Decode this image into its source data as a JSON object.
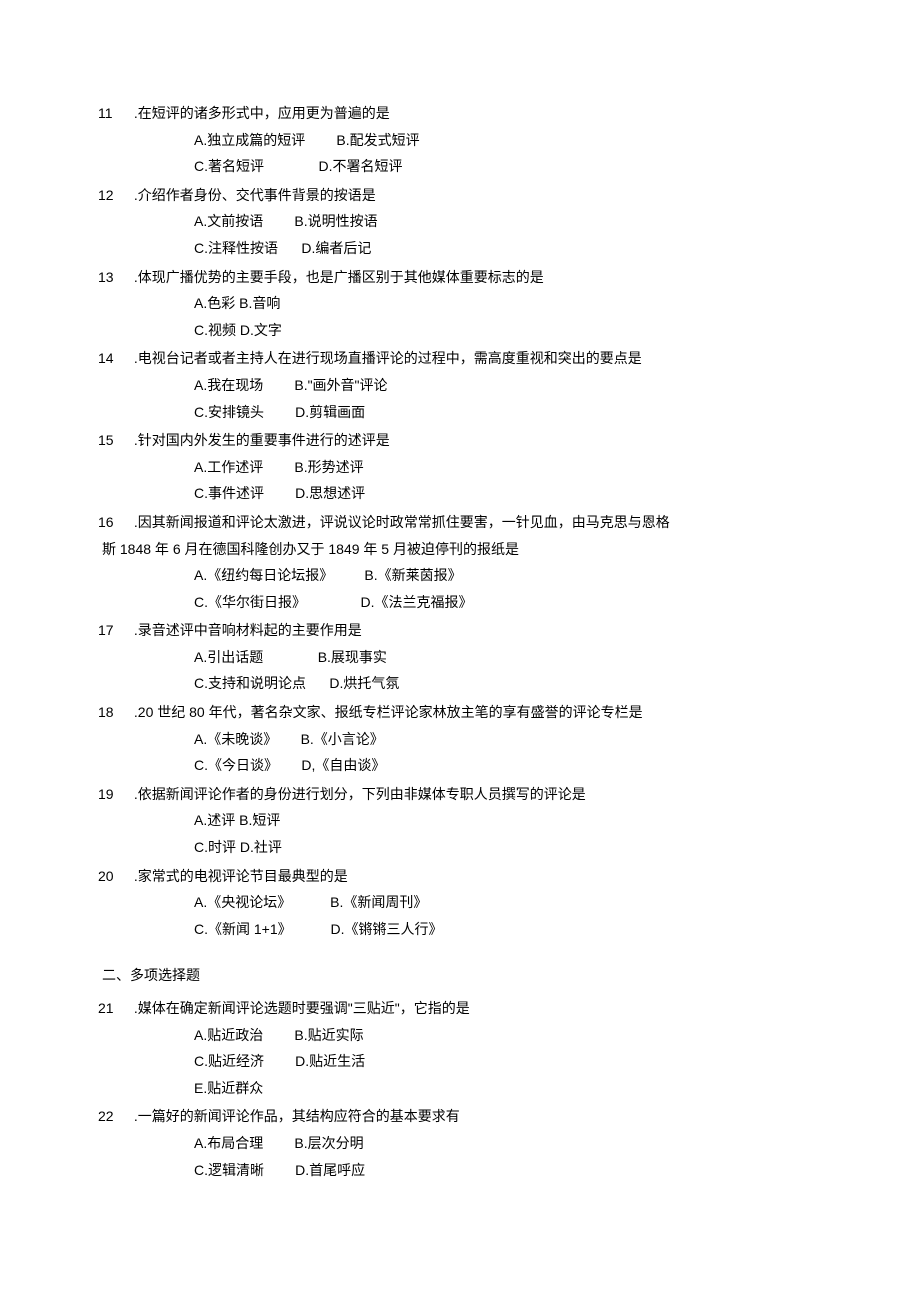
{
  "q11": {
    "num": "11",
    "stem": " .在短评的诸多形式中，应用更为普遍的是",
    "row1a": "A.独立成篇的短评",
    "row1b": "B.配发式短评",
    "row2a": "C.著名短评",
    "row2b": "D.不署名短评"
  },
  "q12": {
    "num": "12",
    "stem": " .介绍作者身份、交代事件背景的按语是",
    "row1a": "A.文前按语",
    "row1b": "B.说明性按语",
    "row2a": "C.注释性按语",
    "row2b": "D.编者后记"
  },
  "q13": {
    "num": "13",
    "stem": " .体现广播优势的主要手段，也是广播区别于其他媒体重要标志的是",
    "row1": "A.色彩 B.音响",
    "row2": "C.视频 D.文字"
  },
  "q14": {
    "num": "14",
    "stem": " .电视台记者或者主持人在进行现场直播评论的过程中，需高度重视和突出的要点是",
    "row1a": "A.我在现场",
    "row1b": "B.\"画外音\"评论",
    "row2a": "C.安排镜头",
    "row2b": "D.剪辑画面"
  },
  "q15": {
    "num": "15",
    "stem": " .针对国内外发生的重要事件进行的述评是",
    "row1a": "A.工作述评",
    "row1b": "B.形势述评",
    "row2a": "C.事件述评",
    "row2b": "D.思想述评"
  },
  "q16": {
    "num": "16",
    "stem": " .因其新闻报道和评论太激进，评说议论时政常常抓住要害，一针见血，由马克思与恩格",
    "stem2": "斯 1848 年 6 月在德国科隆创办又于 1849 年 5 月被迫停刊的报纸是",
    "row1a": "A.《纽约每日论坛报》",
    "row1b": "B.《新莱茵报》",
    "row2a": "C.《华尔街日报》",
    "row2b": "D.《法兰克福报》"
  },
  "q17": {
    "num": "17",
    "stem": " .录音述评中音响材料起的主要作用是",
    "row1a": "A.引出话题",
    "row1b": "B.展现事实",
    "row2a": "C.支持和说明论点",
    "row2b": "D.烘托气氛"
  },
  "q18": {
    "num": "18",
    "stem": " .20 世纪 80 年代，著名杂文家、报纸专栏评论家林放主笔的享有盛誉的评论专栏是",
    "row1a": "A.《未晚谈》",
    "row1b": "B.《小言论》",
    "row2a": "C.《今日谈》",
    "row2b": "D,《自由谈》"
  },
  "q19": {
    "num": "19",
    "stem": " .依据新闻评论作者的身份进行划分，下列由非媒体专职人员撰写的评论是",
    "row1": "A.述评 B.短评",
    "row2": "C.时评 D.社评"
  },
  "q20": {
    "num": "20",
    "stem": " .家常式的电视评论节目最典型的是",
    "row1a": "A.《央视论坛》",
    "row1b": "B.《新闻周刊》",
    "row2a": "C.《新闻 1+1》",
    "row2b": "D.《锵锵三人行》"
  },
  "section2": "二、多项选择题",
  "q21": {
    "num": "21",
    "stem": " .媒体在确定新闻评论选题时要强调\"三贴近\"，它指的是",
    "row1a": "A.贴近政治",
    "row1b": "B.贴近实际",
    "row2a": "C.贴近经济",
    "row2b": "D.贴近生活",
    "row3": "E.贴近群众"
  },
  "q22": {
    "num": "22",
    "stem": " .一篇好的新闻评论作品，其结构应符合的基本要求有",
    "row1a": "A.布局合理",
    "row1b": "B.层次分明",
    "row2a": "C.逻辑清晰",
    "row2b": "D.首尾呼应"
  }
}
